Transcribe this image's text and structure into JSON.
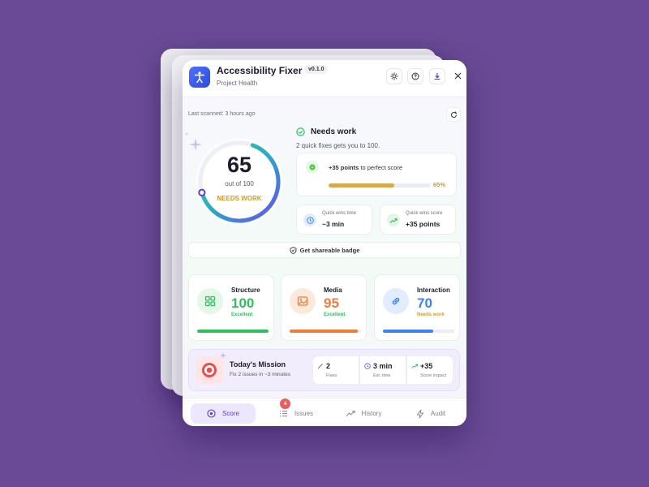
{
  "app": {
    "title": "Accessibility Fixer",
    "version": "v0.1.0",
    "subtitle": "Project Health"
  },
  "header_actions": [
    {
      "name": "settings",
      "icon": "gear-icon"
    },
    {
      "name": "help",
      "icon": "question-icon"
    },
    {
      "name": "download",
      "icon": "download-icon"
    },
    {
      "name": "close",
      "icon": "close-icon"
    }
  ],
  "scan": {
    "last_scanned": "Last scanned: 3 hours ago"
  },
  "score": {
    "value": "65",
    "out_of": "out of 100",
    "status": "NEEDS WORK",
    "fraction": 0.65
  },
  "summary": {
    "title": "Needs work",
    "subtitle": "2 quick fixes gets you to 100.",
    "points_strong": "+35 points",
    "points_rest": " to perfect score",
    "progress_label": "65%",
    "progress": 0.65
  },
  "quick_wins": [
    {
      "label": "Quick wins time",
      "value": "~3 min",
      "icon": "clock-icon"
    },
    {
      "label": "Quick wins score",
      "value": "+35 points",
      "icon": "trend-up-icon"
    }
  ],
  "badge_button": "Get shareable badge",
  "categories": [
    {
      "name": "Structure",
      "score": "100",
      "status": "Excellent",
      "progress": 1.0,
      "color": "#2fbf5d",
      "bg": "#e4f7e9",
      "icon": "grid-icon"
    },
    {
      "name": "Media",
      "score": "95",
      "status": "Excellent",
      "progress": 0.95,
      "color": "#f27b35",
      "bg": "#fde9dc",
      "icon": "image-icon"
    },
    {
      "name": "Interaction",
      "score": "70",
      "status": "Needs work",
      "progress": 0.7,
      "color": "#3b82f6",
      "bg": "#e2ecfe",
      "icon": "link-icon"
    }
  ],
  "category_status_colors": {
    "Excellent": "#2fbf5d",
    "Needs work": "#e09a25"
  },
  "mission": {
    "title": "Today's Mission",
    "subtitle": "Fix 2 issues in ~3 minutes",
    "stats": [
      {
        "value": "2",
        "label": "Fixes",
        "icon": "wand-icon"
      },
      {
        "value": "3 min",
        "label": "Est. time",
        "icon": "clock-icon"
      },
      {
        "value": "+35",
        "label": "Score impact",
        "icon": "trend-up-icon"
      }
    ]
  },
  "nav": {
    "items": [
      {
        "label": "Score",
        "icon": "target-icon",
        "active": true
      },
      {
        "label": "Issues",
        "icon": "list-icon",
        "badge": "4"
      },
      {
        "label": "History",
        "icon": "trend-icon"
      },
      {
        "label": "Audit",
        "icon": "bolt-icon"
      }
    ]
  },
  "colors": {
    "background": "#6a4a96",
    "accent": "#5a3fd8",
    "warning": "#d99a22",
    "success": "#2fbf5d"
  }
}
